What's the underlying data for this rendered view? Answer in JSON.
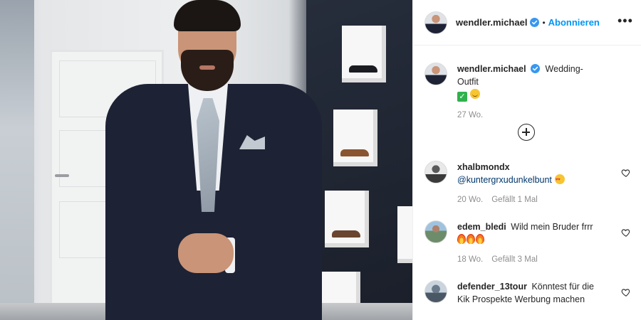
{
  "post": {
    "username": "wendler.michael",
    "follow_label": "Abonnieren",
    "separator": "•",
    "more_icon": "more-options-icon",
    "caption": {
      "username": "wendler.michael",
      "text": "Wedding- Outfit",
      "time": "27 Wo."
    },
    "load_more_icon": "plus-circle-icon",
    "comments": [
      {
        "username": "xhalbmondx",
        "text": "@kuntergrxudunkelbunt",
        "time": "20 Wo.",
        "likes": "Gefällt 1 Mal"
      },
      {
        "username": "edem_bledi",
        "text": "Wild mein Bruder frrr",
        "time": "18 Wo.",
        "likes": "Gefällt 3 Mal"
      },
      {
        "username": "defender_13tour",
        "text": "Könntest für die Kik Prospekte Werbung machen"
      }
    ],
    "colors": {
      "accent": "#0095f6",
      "verified": "#3897f0",
      "meta": "#8e8e8e",
      "text": "#262626"
    }
  }
}
